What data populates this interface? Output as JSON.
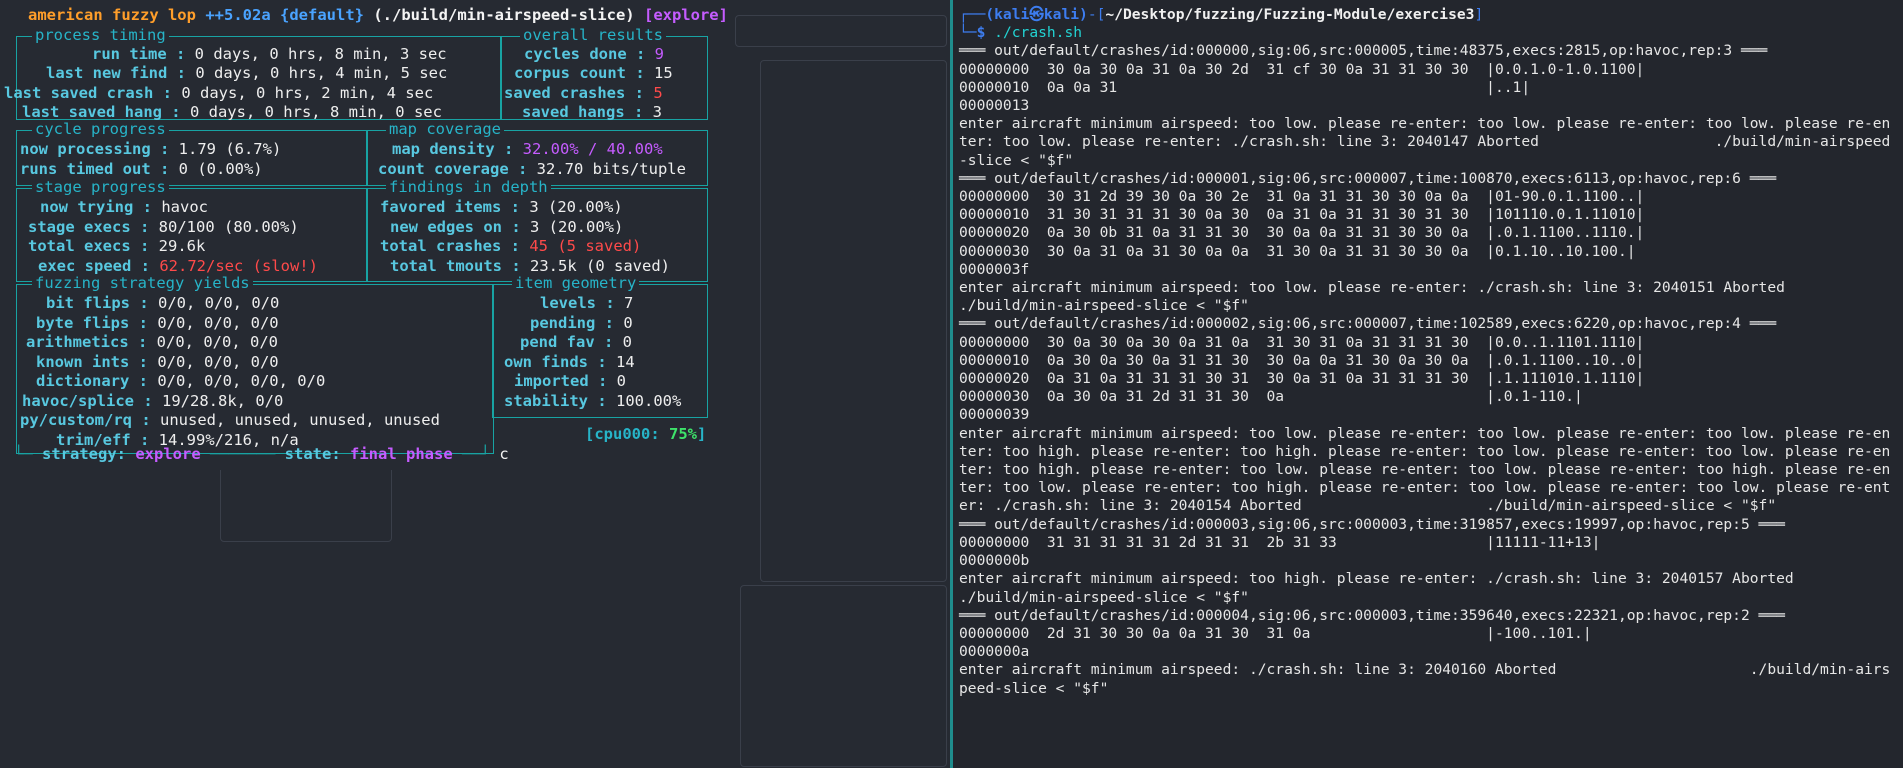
{
  "afl": {
    "header": {
      "program": "american fuzzy lop",
      "version": "++5.02a",
      "profile": "{default}",
      "target": "(./build/min-airspeed-slice)",
      "mode": "[explore]"
    },
    "process_timing": {
      "title": "process timing",
      "run_time_label": "run time :",
      "run_time": "0 days, 0 hrs, 8 min, 3 sec",
      "last_new_find_label": "last new find :",
      "last_new_find": "0 days, 0 hrs, 4 min, 5 sec",
      "last_saved_crash_label": "last saved crash :",
      "last_saved_crash": "0 days, 0 hrs, 2 min, 4 sec",
      "last_saved_hang_label": "last saved hang :",
      "last_saved_hang": "0 days, 0 hrs, 8 min, 0 sec"
    },
    "overall_results": {
      "title": "overall results",
      "cycles_done_label": "cycles done :",
      "cycles_done": "9",
      "corpus_count_label": "corpus count :",
      "corpus_count": "15",
      "saved_crashes_label": "saved crashes :",
      "saved_crashes": "5",
      "saved_hangs_label": "saved hangs :",
      "saved_hangs": "3"
    },
    "cycle_progress": {
      "title": "cycle progress",
      "now_processing_label": "now processing :",
      "now_processing": "1.79 (6.7%)",
      "runs_timed_out_label": "runs timed out :",
      "runs_timed_out": "0 (0.00%)"
    },
    "map_coverage": {
      "title": "map coverage",
      "map_density_label": "map density :",
      "map_density": "32.00% / 40.00%",
      "count_coverage_label": "count coverage :",
      "count_coverage": "32.70 bits/tuple"
    },
    "stage_progress": {
      "title": "stage progress",
      "now_trying_label": "now trying :",
      "now_trying": "havoc",
      "stage_execs_label": "stage execs :",
      "stage_execs": "80/100 (80.00%)",
      "total_execs_label": "total execs :",
      "total_execs": "29.6k",
      "exec_speed_label": "exec speed :",
      "exec_speed": "62.72/sec (slow!)"
    },
    "findings": {
      "title": "findings in depth",
      "favored_items_label": "favored items :",
      "favored_items": "3 (20.00%)",
      "new_edges_label": "new edges on :",
      "new_edges": "3 (20.00%)",
      "total_crashes_label": "total crashes :",
      "total_crashes": "45 (5 saved)",
      "total_tmouts_label": "total tmouts :",
      "total_tmouts": "23.5k (0 saved)"
    },
    "strategy_yields": {
      "title": "fuzzing strategy yields",
      "bit_flips_label": "bit flips :",
      "bit_flips": "0/0, 0/0, 0/0",
      "byte_flips_label": "byte flips :",
      "byte_flips": "0/0, 0/0, 0/0",
      "arithmetics_label": "arithmetics :",
      "arithmetics": "0/0, 0/0, 0/0",
      "known_ints_label": "known ints :",
      "known_ints": "0/0, 0/0, 0/0",
      "dictionary_label": "dictionary :",
      "dictionary": "0/0, 0/0, 0/0, 0/0",
      "havoc_splice_label": "havoc/splice :",
      "havoc_splice": "19/28.8k, 0/0",
      "py_custom_label": "py/custom/rq :",
      "py_custom": "unused, unused, unused, unused",
      "trim_eff_label": "trim/eff :",
      "trim_eff": "14.99%/216, n/a"
    },
    "item_geometry": {
      "title": "item geometry",
      "levels_label": "levels :",
      "levels": "7",
      "pending_label": "pending :",
      "pending": "0",
      "pend_fav_label": "pend fav :",
      "pend_fav": "0",
      "own_finds_label": "own finds :",
      "own_finds": "14",
      "imported_label": "imported :",
      "imported": "0",
      "stability_label": "stability :",
      "stability": "100.00%"
    },
    "cpu_label": "[cpu000:",
    "cpu_value": "75%",
    "cpu_close": "]",
    "footer": {
      "strategy_label": "strategy:",
      "strategy": "explore",
      "state_label": "state:",
      "state": "final phase",
      "cursor_char": "c"
    }
  },
  "terminal": {
    "prompt_user": "(kali㉿kali)",
    "prompt_path": "~/Desktop/fuzzing/Fuzzing-Module/exercise3",
    "command": "./crash.sh",
    "lines": [
      "═══ out/default/crashes/id:000000,sig:06,src:000005,time:48375,execs:2815,op:havoc,rep:3 ═══",
      "00000000  30 0a 30 0a 31 0a 30 2d  31 cf 30 0a 31 31 30 30  |0.0.1.0-1.0.1100|",
      "00000010  0a 0a 31                                          |..1|",
      "00000013",
      "enter aircraft minimum airspeed: too low. please re-enter: too low. please re-enter: too low. please re-enter: too low. please re-enter: ./crash.sh: line 3: 2040147 Aborted                    ./build/min-airspeed-slice < \"$f\"",
      "═══ out/default/crashes/id:000001,sig:06,src:000007,time:100870,execs:6113,op:havoc,rep:6 ═══",
      "00000000  30 31 2d 39 30 0a 30 2e  31 0a 31 31 30 30 0a 0a  |01-90.0.1.1100..|",
      "00000010  31 30 31 31 31 30 0a 30  0a 31 0a 31 31 30 31 30  |101110.0.1.11010|",
      "00000020  0a 30 0b 31 0a 31 31 30  30 0a 0a 31 31 30 30 0a  |.0.1.1100..1110.|",
      "00000030  30 0a 31 0a 31 30 0a 0a  31 30 0a 31 31 30 30 0a  |0.1.10..10.100.|",
      "0000003f",
      "enter aircraft minimum airspeed: too low. please re-enter: ./crash.sh: line 3: 2040151 Aborted                 ./build/min-airspeed-slice < \"$f\"",
      "═══ out/default/crashes/id:000002,sig:06,src:000007,time:102589,execs:6220,op:havoc,rep:4 ═══",
      "00000000  30 0a 30 0a 30 0a 31 0a  31 30 31 0a 31 31 31 30  |0.0..1.1101.1110|",
      "00000010  0a 30 0a 30 0a 31 31 30  30 0a 0a 31 30 0a 30 0a  |.0.1.1100..10..0|",
      "00000020  0a 31 0a 31 31 31 30 31  30 0a 31 0a 31 31 31 30  |.1.111010.1.1110|",
      "00000030  0a 30 0a 31 2d 31 31 30  0a                       |.0.1-110.|",
      "00000039",
      "enter aircraft minimum airspeed: too low. please re-enter: too low. please re-enter: too low. please re-enter: too high. please re-enter: too high. please re-enter: too low. please re-enter: too low. please re-enter: too high. please re-enter: too low. please re-enter: too low. please re-enter: too high. please re-enter: too low. please re-enter: too high. please re-enter: too low. please re-enter: too low. please re-enter: ./crash.sh: line 3: 2040154 Aborted                     ./build/min-airspeed-slice < \"$f\"",
      "═══ out/default/crashes/id:000003,sig:06,src:000003,time:319857,execs:19997,op:havoc,rep:5 ═══",
      "00000000  31 31 31 31 31 2d 31 31  2b 31 33                 |11111-11+13|",
      "0000000b",
      "enter aircraft minimum airspeed: too high. please re-enter: ./crash.sh: line 3: 2040157 Aborted                  ./build/min-airspeed-slice < \"$f\"",
      "═══ out/default/crashes/id:000004,sig:06,src:000003,time:359640,execs:22321,op:havoc,rep:2 ═══",
      "00000000  2d 31 30 30 0a 0a 31 30  31 0a                    |-100..101.|",
      "0000000a",
      "enter aircraft minimum airspeed: ./crash.sh: line 3: 2040160 Aborted                      ./build/min-airspeed-slice < \"$f\""
    ]
  }
}
